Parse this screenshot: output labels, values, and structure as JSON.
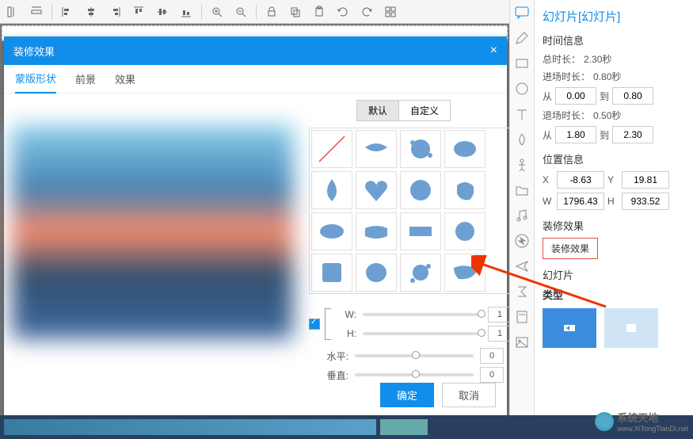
{
  "dialog": {
    "title": "装修效果",
    "close": "×",
    "tabs": {
      "mask": "蒙版形状",
      "foreground": "前景",
      "effect": "效果"
    },
    "shape_tabs": {
      "default": "默认",
      "custom": "自定义"
    },
    "sliders": {
      "w": "W:",
      "h": "H:",
      "horiz": "水平:",
      "vert": "垂直:",
      "w_val": "1",
      "h_val": "1",
      "horiz_val": "0",
      "vert_val": "0"
    },
    "buttons": {
      "ok": "确定",
      "cancel": "取消"
    }
  },
  "props": {
    "title": "幻灯片[幻灯片]",
    "time_section": "时间信息",
    "total_label": "总时长：",
    "total_val": "2.30秒",
    "enter_label": "进场时长：",
    "enter_val": "0.80秒",
    "from": "从",
    "to": "到",
    "from1": "0.00",
    "to1": "0.80",
    "exit_label": "退场时长：",
    "exit_val": "0.50秒",
    "from2": "1.80",
    "to2": "2.30",
    "pos_section": "位置信息",
    "x_label": "X",
    "x_val": "-8.63",
    "y_label": "Y",
    "y_val": "19.81",
    "w_label": "W",
    "w_val": "1796.43",
    "h_label": "H",
    "h_val": "933.52",
    "effect_section": "装修效果",
    "effect_btn": "装修效果",
    "slide_section": "幻灯片",
    "type_label": "类型"
  },
  "watermark": {
    "name": "系统天地",
    "url": "www.XiTongTianDi.net"
  }
}
